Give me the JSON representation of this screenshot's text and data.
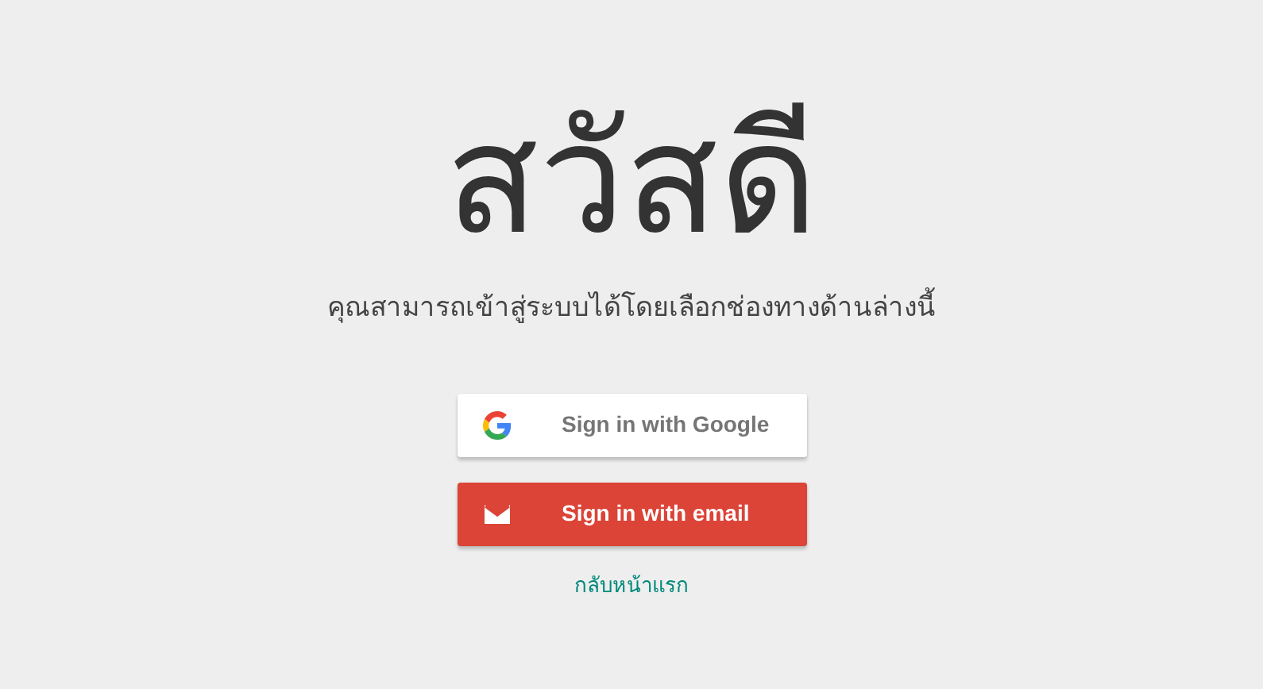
{
  "heading": "สวัสดี",
  "subtitle": "คุณสามารถเข้าสู่ระบบได้โดยเลือกช่องทางด้านล่างนี้",
  "buttons": [
    {
      "kind": "google",
      "label": "Sign in with Google"
    },
    {
      "kind": "email",
      "label": "Sign in with email"
    }
  ],
  "link": "กลับหน้าแรก"
}
